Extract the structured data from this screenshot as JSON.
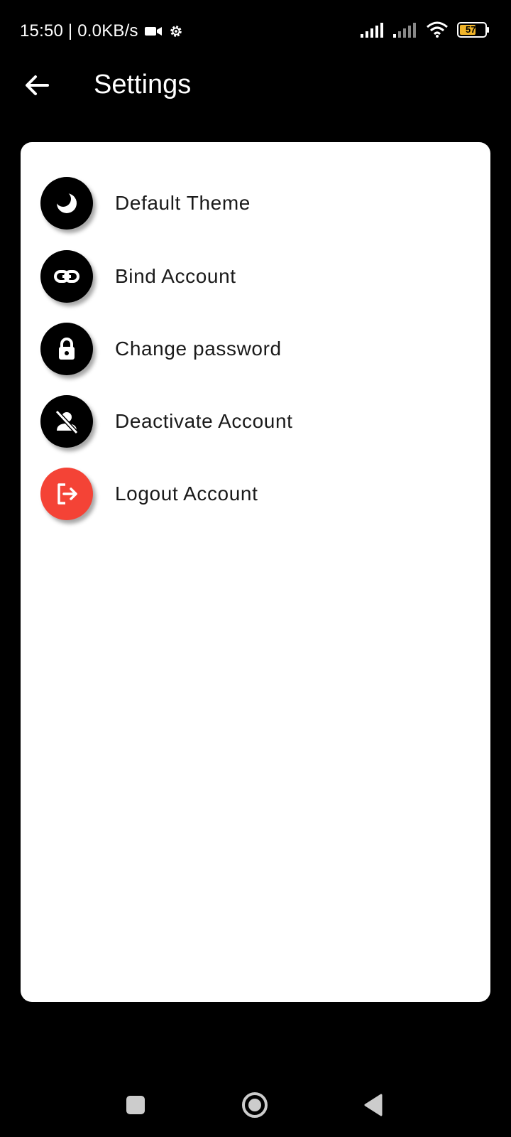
{
  "status_bar": {
    "time_and_speed": "15:50 | 0.0KB/s",
    "battery_level": "57",
    "icons": [
      "video-camera-icon",
      "settings-gear-icon",
      "signal-icon",
      "signal-weak-icon",
      "wifi-icon",
      "battery-icon"
    ]
  },
  "app_bar": {
    "title": "Settings",
    "back_icon": "arrow-left-icon"
  },
  "menu": {
    "items": [
      {
        "label": "Default Theme",
        "icon": "moon-icon",
        "color": "#000000"
      },
      {
        "label": "Bind Account",
        "icon": "link-icon",
        "color": "#000000"
      },
      {
        "label": "Change password",
        "icon": "lock-icon",
        "color": "#000000"
      },
      {
        "label": "Deactivate Account",
        "icon": "user-off-icon",
        "color": "#000000"
      },
      {
        "label": "Logout Account",
        "icon": "logout-icon",
        "color": "#f44336"
      }
    ]
  },
  "nav_bar": {
    "buttons": [
      "recent-apps-icon",
      "home-icon",
      "back-triangle-icon"
    ]
  }
}
